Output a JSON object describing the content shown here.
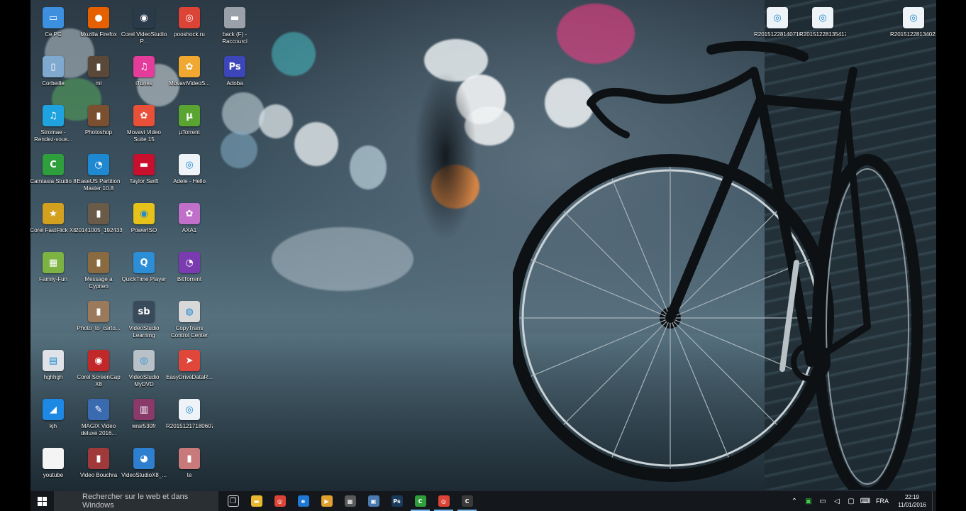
{
  "desktop": {
    "icons": [
      {
        "label": "Ce PC",
        "icon": "pc-icon",
        "color": "#3d8fe0",
        "glyph": "▭"
      },
      {
        "label": "Mozilla Firefox",
        "icon": "firefox-icon",
        "color": "#e66000",
        "glyph": "●"
      },
      {
        "label": "Corel VideoStudio P...",
        "icon": "camera-icon",
        "color": "#2b3a49",
        "glyph": "◉"
      },
      {
        "label": "pooshock.ru",
        "icon": "chrome-icon",
        "color": "#db4437",
        "glyph": "◎"
      },
      {
        "label": "back (F) - Raccourci",
        "icon": "drive-icon",
        "color": "#9aa1a8",
        "glyph": "▬"
      },
      {
        "label": "Corbeille",
        "icon": "recycle-bin-icon",
        "color": "#7fa9cf",
        "glyph": "▯"
      },
      {
        "label": "ml",
        "icon": "image-file-icon",
        "color": "#5a4838",
        "glyph": "▮"
      },
      {
        "label": "iTunes",
        "icon": "itunes-icon",
        "color": "#e43c9a",
        "glyph": "♫"
      },
      {
        "label": "MovaviVideoS...",
        "icon": "movavi-icon",
        "color": "#f0a830",
        "glyph": "✿"
      },
      {
        "label": "Adoba",
        "icon": "adobe-icon",
        "color": "#3c46b8",
        "glyph": "Ps"
      },
      {
        "label": "Stromae - Rendez-vous...",
        "icon": "music-file-icon",
        "color": "#1fa3e0",
        "glyph": "♫"
      },
      {
        "label": "Photoshop",
        "icon": "image-file-icon",
        "color": "#7a5030",
        "glyph": "▮"
      },
      {
        "label": "Movavi Video Suite 15",
        "icon": "movavi-icon",
        "color": "#e8503a",
        "glyph": "✿"
      },
      {
        "label": "µTorrent",
        "icon": "utorrent-icon",
        "color": "#5aa532",
        "glyph": "µ"
      },
      {
        "label": "Camtasia Studio 8",
        "icon": "camtasia-icon",
        "color": "#2f9e3c",
        "glyph": "C"
      },
      {
        "label": "EaseUS Partition Master 10.8",
        "icon": "partition-icon",
        "color": "#1e88d0",
        "glyph": "◔"
      },
      {
        "label": "Taylor Swift",
        "icon": "folder-red-icon",
        "color": "#c8102e",
        "glyph": "▬"
      },
      {
        "label": "Adele - Hello",
        "icon": "document-icon",
        "color": "#eef3f7",
        "glyph": "◎"
      },
      {
        "label": "Corel FastFlick X8",
        "icon": "fastflick-icon",
        "color": "#d4a020",
        "glyph": "★"
      },
      {
        "label": "20141005_192433",
        "icon": "image-file-icon",
        "color": "#6a5a48",
        "glyph": "▮"
      },
      {
        "label": "PowerISO",
        "icon": "disc-icon",
        "color": "#e6c21a",
        "glyph": "◉"
      },
      {
        "label": "AXA1",
        "icon": "flower-icon",
        "color": "#c070c8",
        "glyph": "✿"
      },
      {
        "label": "Family-Fun",
        "icon": "picture-icon",
        "color": "#7cb342",
        "glyph": "▦"
      },
      {
        "label": "Message a Cyprien",
        "icon": "image-file-icon",
        "color": "#8a6a40",
        "glyph": "▮"
      },
      {
        "label": "QuickTime Player",
        "icon": "quicktime-icon",
        "color": "#2d8ed8",
        "glyph": "Q"
      },
      {
        "label": "BitTorrent",
        "icon": "bittorrent-icon",
        "color": "#7a3bb0",
        "glyph": "◔"
      },
      {
        "label": "Photo_to_carto...",
        "icon": "image-file-icon",
        "color": "#9a7a5a",
        "glyph": "▮"
      },
      {
        "label": "VideoStudio Learning",
        "icon": "learning-icon",
        "color": "#394a5a",
        "glyph": "sb"
      },
      {
        "label": "CopyTrans Control Center",
        "icon": "copytrans-icon",
        "color": "#d8d8d8",
        "glyph": "◍"
      },
      {
        "label": "hghhgh",
        "icon": "document-icon",
        "color": "#dfe3e8",
        "glyph": "▤"
      },
      {
        "label": "Corel ScreenCap X8",
        "icon": "screencap-icon",
        "color": "#c0282a",
        "glyph": "◉"
      },
      {
        "label": "VideoStudio MyDVD",
        "icon": "dvd-icon",
        "color": "#b8c0c8",
        "glyph": "◎"
      },
      {
        "label": "EasyDriveDataR...",
        "icon": "recovery-icon",
        "color": "#e0463a",
        "glyph": "➤"
      },
      {
        "label": "kjh",
        "icon": "shape-icon",
        "color": "#1e88e5",
        "glyph": "◢"
      },
      {
        "label": "MAGIX Video deluxe 2016...",
        "icon": "magix-icon",
        "color": "#3a6bb0",
        "glyph": "✎"
      },
      {
        "label": "wrar530fr",
        "icon": "winrar-icon",
        "color": "#8a3a6a",
        "glyph": "▥"
      },
      {
        "label": "R20151217180607",
        "icon": "document-icon",
        "color": "#eef3f7",
        "glyph": "◎"
      },
      {
        "label": "youtube",
        "icon": "blank-file-icon",
        "color": "#f4f4f4",
        "glyph": ""
      },
      {
        "label": "Video Bouchra",
        "icon": "image-file-icon",
        "color": "#a03a3a",
        "glyph": "▮"
      },
      {
        "label": "VideoStudioX8_...",
        "icon": "installer-icon",
        "color": "#2f7fd0",
        "glyph": "◕"
      },
      {
        "label": "te",
        "icon": "image-file-icon",
        "color": "#c87a7a",
        "glyph": "▮"
      }
    ],
    "top_right_icons": [
      {
        "label": "R20151228140716",
        "icon": "document-icon",
        "color": "#eef3f7",
        "glyph": "◎"
      },
      {
        "label": "R20151228135417",
        "icon": "document-icon",
        "color": "#eef3f7",
        "glyph": "◎"
      },
      {
        "label": "R20151228134021",
        "icon": "document-icon",
        "color": "#eef3f7",
        "glyph": "◎"
      }
    ]
  },
  "taskbar": {
    "search_placeholder": "Rechercher sur le web et dans Windows",
    "apps": [
      {
        "name": "task-view-icon",
        "glyph": "❐",
        "color": "transparent",
        "active": false
      },
      {
        "name": "file-explorer-icon",
        "glyph": "▬",
        "color": "#e8b830",
        "active": false
      },
      {
        "name": "chrome-icon",
        "glyph": "◎",
        "color": "#db4437",
        "active": false
      },
      {
        "name": "edge-icon",
        "glyph": "e",
        "color": "#1e78d4",
        "active": false
      },
      {
        "name": "media-player-icon",
        "glyph": "▶",
        "color": "#e0a030",
        "active": false
      },
      {
        "name": "store-icon",
        "glyph": "▦",
        "color": "#5a5a5a",
        "active": false
      },
      {
        "name": "network-app-icon",
        "glyph": "▣",
        "color": "#4a7ab0",
        "active": false
      },
      {
        "name": "photoshop-icon",
        "glyph": "Ps",
        "color": "#1a3a5a",
        "active": false
      },
      {
        "name": "camtasia-icon",
        "glyph": "C",
        "color": "#2f9e3c",
        "active": true
      },
      {
        "name": "chrome-running-icon",
        "glyph": "◎",
        "color": "#db4437",
        "active": true
      },
      {
        "name": "camtasia-recorder-icon",
        "glyph": "C",
        "color": "#3a3a3a",
        "active": true
      }
    ],
    "tray": {
      "language": "FRA",
      "time": "22:19",
      "date": "11/01/2016"
    }
  }
}
